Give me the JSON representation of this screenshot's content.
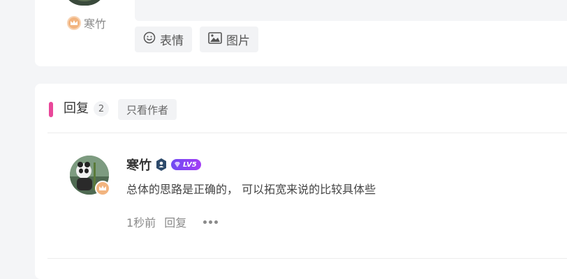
{
  "top_section": {
    "username": "寒竹",
    "emoji_button": "表情",
    "image_button": "图片"
  },
  "replies": {
    "title": "回复",
    "count": "2",
    "author_only_button": "只看作者"
  },
  "comment": {
    "username": "寒竹",
    "level": "LV5",
    "text": "总体的思路是正确的， 可以拓宽来说的比较具体些",
    "time": "1秒前",
    "reply_label": "回复"
  },
  "colors": {
    "accent": "#e9479a",
    "level_badge": "#8a45f3",
    "crown": "#f2b47f"
  }
}
